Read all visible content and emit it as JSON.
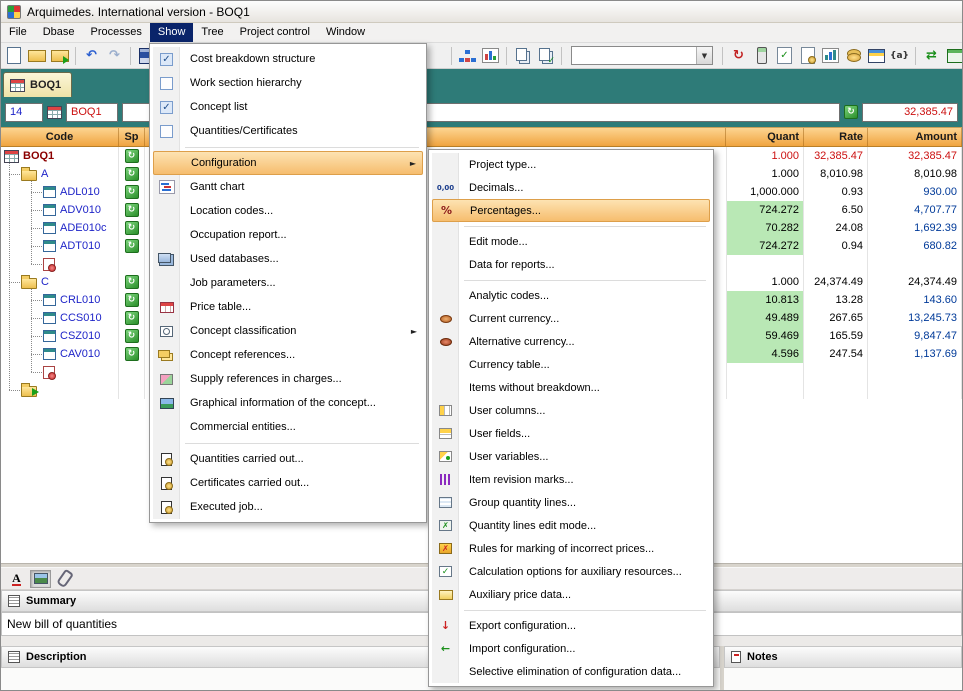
{
  "window": {
    "title": "Arquimedes. International version - BOQ1"
  },
  "menubar": {
    "items": [
      {
        "label": "File"
      },
      {
        "label": "Dbase"
      },
      {
        "label": "Processes"
      },
      {
        "label": "Show",
        "active": true
      },
      {
        "label": "Tree"
      },
      {
        "label": "Project control"
      },
      {
        "label": "Window"
      }
    ]
  },
  "toolbar": {
    "combo_value": "",
    "groups": [
      [
        "new",
        "open",
        "opendb"
      ],
      [
        "undo",
        "redo"
      ],
      [
        "save"
      ],
      [
        "spacer"
      ],
      [
        "flow",
        "chart"
      ],
      [
        "copy",
        "copy2"
      ],
      [
        "combo"
      ],
      [
        "update",
        "mobile",
        "checkdoc",
        "sealdoc",
        "barchart",
        "coins",
        "pricetable",
        "braces"
      ],
      [
        "transfer",
        "greentable",
        "report"
      ]
    ]
  },
  "tab": {
    "label": "BOQ1"
  },
  "fields": {
    "level": "14",
    "database": "BOQ1",
    "total": "32,385.47"
  },
  "table": {
    "columns": [
      "Code",
      "Sp",
      "Quant",
      "Rate",
      "Amount"
    ],
    "rows": [
      {
        "type": "root",
        "code": "BOQ1",
        "sp": true,
        "quant": "1.000",
        "rate": "32,385.47",
        "amount": "32,385.47"
      },
      {
        "type": "folder",
        "code": "A",
        "sp": true,
        "quant": "1.000",
        "rate": "8,010.98",
        "amount": "8,010.98"
      },
      {
        "type": "item",
        "code": "ADL010",
        "sp": true,
        "quant": "1,000.000",
        "rate": "0.93",
        "amount": "930.00"
      },
      {
        "type": "item",
        "code": "ADV010",
        "sp": true,
        "green": true,
        "quant": "724.272",
        "rate": "6.50",
        "amount": "4,707.77"
      },
      {
        "type": "item",
        "code": "ADE010c",
        "sp": true,
        "green": true,
        "quant": "70.282",
        "rate": "24.08",
        "amount": "1,692.39"
      },
      {
        "type": "item",
        "code": "ADT010",
        "sp": true,
        "green": true,
        "quant": "724.272",
        "rate": "0.94",
        "amount": "680.82"
      },
      {
        "type": "cert"
      },
      {
        "type": "folder",
        "code": "C",
        "sp": true,
        "quant": "1.000",
        "rate": "24,374.49",
        "amount": "24,374.49"
      },
      {
        "type": "item",
        "code": "CRL010",
        "sp": true,
        "green": true,
        "quant": "10.813",
        "rate": "13.28",
        "amount": "143.60"
      },
      {
        "type": "item",
        "code": "CCS010",
        "sp": true,
        "green": true,
        "quant": "49.489",
        "rate": "267.65",
        "amount": "13,245.73"
      },
      {
        "type": "item",
        "code": "CSZ010",
        "sp": true,
        "green": true,
        "quant": "59.469",
        "rate": "165.59",
        "amount": "9,847.47"
      },
      {
        "type": "item",
        "code": "CAV010",
        "sp": true,
        "green": true,
        "quant": "4.596",
        "rate": "247.54",
        "amount": "1,137.69"
      },
      {
        "type": "cert"
      },
      {
        "type": "newfolder"
      }
    ]
  },
  "show_menu": {
    "items": [
      {
        "label": "Cost breakdown structure",
        "check": true
      },
      {
        "label": "Work section hierarchy",
        "check": false
      },
      {
        "label": "Concept list",
        "check": true
      },
      {
        "label": "Quantities/Certificates",
        "check": false
      },
      {
        "sep": true
      },
      {
        "label": "Configuration",
        "submenu": true,
        "highlight": true
      },
      {
        "label": "Gantt chart",
        "icon": "gantt"
      },
      {
        "label": "Location codes..."
      },
      {
        "label": "Occupation report..."
      },
      {
        "label": "Used databases...",
        "icon": "databases"
      },
      {
        "label": "Job parameters..."
      },
      {
        "label": "Price table...",
        "icon": "pricetable"
      },
      {
        "label": "Concept classification",
        "icon": "classif",
        "submenu": true
      },
      {
        "label": "Concept references...",
        "icon": "refs"
      },
      {
        "label": "Supply references in charges...",
        "icon": "supply"
      },
      {
        "label": "Graphical information of the concept...",
        "icon": "graph"
      },
      {
        "label": "Commercial entities..."
      },
      {
        "sep": true
      },
      {
        "label": "Quantities carried out...",
        "icon": "stamp"
      },
      {
        "label": "Certificates carried out...",
        "icon": "stamp"
      },
      {
        "label": "Executed job...",
        "icon": "stamp"
      }
    ]
  },
  "config_menu": {
    "items": [
      {
        "label": "Project type..."
      },
      {
        "label": "Decimals...",
        "icon": "decimals"
      },
      {
        "label": "Percentages...",
        "icon": "percent",
        "highlight": true
      },
      {
        "sep": true
      },
      {
        "label": "Edit mode..."
      },
      {
        "label": "Data for reports..."
      },
      {
        "sep": true
      },
      {
        "label": "Analytic codes..."
      },
      {
        "label": "Current currency...",
        "icon": "coin"
      },
      {
        "label": "Alternative currency...",
        "icon": "coin2"
      },
      {
        "label": "Currency table..."
      },
      {
        "label": "Items without breakdown..."
      },
      {
        "label": "User columns...",
        "icon": "columns"
      },
      {
        "label": "User fields...",
        "icon": "fields"
      },
      {
        "label": "User variables...",
        "icon": "vars"
      },
      {
        "label": "Item revision marks...",
        "icon": "marks"
      },
      {
        "label": "Group quantity lines...",
        "icon": "group"
      },
      {
        "label": "Quantity lines edit mode...",
        "icon": "editmode"
      },
      {
        "label": "Rules for marking of incorrect prices...",
        "icon": "rules"
      },
      {
        "label": "Calculation options for auxiliary resources...",
        "icon": "calc"
      },
      {
        "label": "Auxiliary price data...",
        "icon": "auxprice"
      },
      {
        "sep": true
      },
      {
        "label": "Export configuration...",
        "icon": "export"
      },
      {
        "label": "Import configuration...",
        "icon": "import"
      },
      {
        "label": "Selective elimination of configuration data..."
      }
    ]
  },
  "bottom": {
    "summary_label": "Summary",
    "summary_text": "New bill of quantities",
    "description_label": "Description",
    "notes_label": "Notes"
  }
}
